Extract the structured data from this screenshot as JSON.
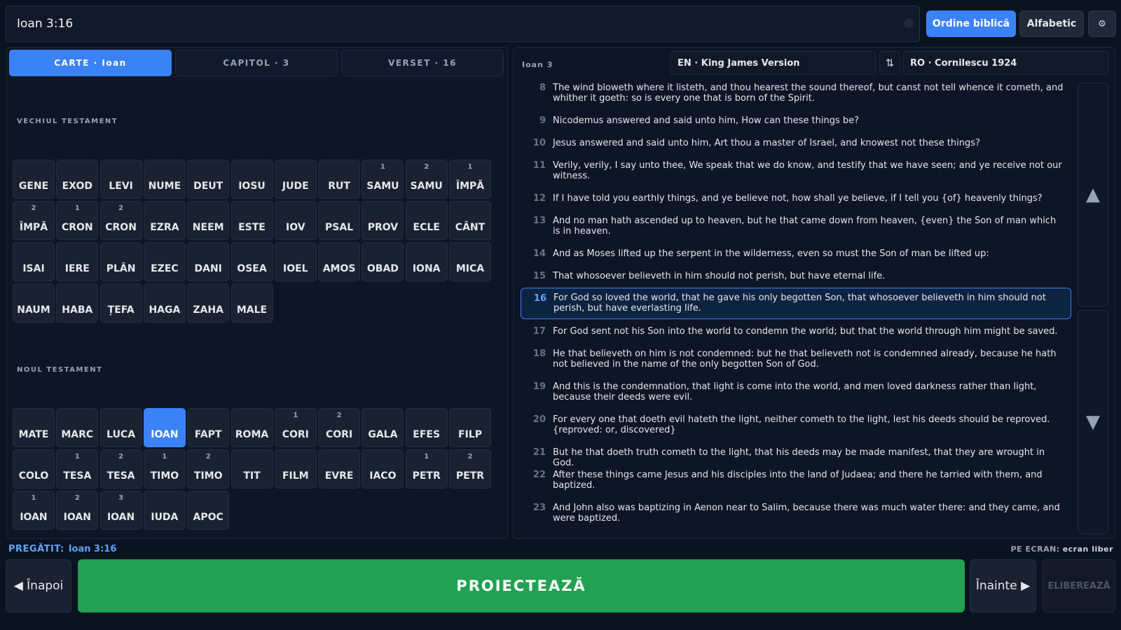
{
  "search": {
    "value": "Ioan 3:16"
  },
  "top_buttons": {
    "biblical_order": "Ordine biblică",
    "alphabetic": "Alfabetic",
    "settings_icon": "gear-icon",
    "settings_glyph": "⚙"
  },
  "tabs": [
    {
      "label": "CARTE  ·  Ioan"
    },
    {
      "label": "CAPITOL  ·  3"
    },
    {
      "label": "VERSET  ·  16"
    }
  ],
  "old_testament": {
    "title": "VECHIUL TESTAMENT",
    "books": [
      {
        "n": "GENE",
        "p": ""
      },
      {
        "n": "EXOD",
        "p": ""
      },
      {
        "n": "LEVI",
        "p": ""
      },
      {
        "n": "NUME",
        "p": ""
      },
      {
        "n": "DEUT",
        "p": ""
      },
      {
        "n": "IOSU",
        "p": ""
      },
      {
        "n": "JUDE",
        "p": ""
      },
      {
        "n": "RUT",
        "p": ""
      },
      {
        "n": "SAMU",
        "p": "1"
      },
      {
        "n": "SAMU",
        "p": "2"
      },
      {
        "n": "ÎMPĂ",
        "p": "1"
      },
      {
        "n": "ÎMPĂ",
        "p": "2"
      },
      {
        "n": "CRON",
        "p": "1"
      },
      {
        "n": "CRON",
        "p": "2"
      },
      {
        "n": "EZRA",
        "p": ""
      },
      {
        "n": "NEEM",
        "p": ""
      },
      {
        "n": "ESTE",
        "p": ""
      },
      {
        "n": "IOV",
        "p": ""
      },
      {
        "n": "PSAL",
        "p": ""
      },
      {
        "n": "PROV",
        "p": ""
      },
      {
        "n": "ECLE",
        "p": ""
      },
      {
        "n": "CÂNT",
        "p": ""
      },
      {
        "n": "ISAI",
        "p": ""
      },
      {
        "n": "IERE",
        "p": ""
      },
      {
        "n": "PLÂN",
        "p": ""
      },
      {
        "n": "EZEC",
        "p": ""
      },
      {
        "n": "DANI",
        "p": ""
      },
      {
        "n": "OSEA",
        "p": ""
      },
      {
        "n": "IOEL",
        "p": ""
      },
      {
        "n": "AMOS",
        "p": ""
      },
      {
        "n": "OBAD",
        "p": ""
      },
      {
        "n": "IONA",
        "p": ""
      },
      {
        "n": "MICA",
        "p": ""
      },
      {
        "n": "NAUM",
        "p": ""
      },
      {
        "n": "HABA",
        "p": ""
      },
      {
        "n": "ȚEFA",
        "p": ""
      },
      {
        "n": "HAGA",
        "p": ""
      },
      {
        "n": "ZAHA",
        "p": ""
      },
      {
        "n": "MALE",
        "p": ""
      }
    ]
  },
  "new_testament": {
    "title": "NOUL TESTAMENT",
    "books": [
      {
        "n": "MATE",
        "p": ""
      },
      {
        "n": "MARC",
        "p": ""
      },
      {
        "n": "LUCA",
        "p": ""
      },
      {
        "n": "IOAN",
        "p": "",
        "selected": true
      },
      {
        "n": "FAPT",
        "p": ""
      },
      {
        "n": "ROMA",
        "p": ""
      },
      {
        "n": "CORI",
        "p": "1"
      },
      {
        "n": "CORI",
        "p": "2"
      },
      {
        "n": "GALA",
        "p": ""
      },
      {
        "n": "EFES",
        "p": ""
      },
      {
        "n": "FILP",
        "p": ""
      },
      {
        "n": "COLO",
        "p": ""
      },
      {
        "n": "TESA",
        "p": "1"
      },
      {
        "n": "TESA",
        "p": "2"
      },
      {
        "n": "TIMO",
        "p": "1"
      },
      {
        "n": "TIMO",
        "p": "2"
      },
      {
        "n": "TIT",
        "p": ""
      },
      {
        "n": "FILM",
        "p": ""
      },
      {
        "n": "EVRE",
        "p": ""
      },
      {
        "n": "IACO",
        "p": ""
      },
      {
        "n": "PETR",
        "p": "1"
      },
      {
        "n": "PETR",
        "p": "2"
      },
      {
        "n": "IOAN",
        "p": "1"
      },
      {
        "n": "IOAN",
        "p": "2"
      },
      {
        "n": "IOAN",
        "p": "3"
      },
      {
        "n": "IUDA",
        "p": ""
      },
      {
        "n": "APOC",
        "p": ""
      }
    ]
  },
  "reader": {
    "chapter": "Ioan 3",
    "version_left": "EN  ·  King James Version",
    "version_right": "RO  ·  Cornilescu 1924",
    "swap_glyph": "⇅",
    "verses": [
      {
        "num": "8",
        "text": "The wind bloweth where it listeth, and thou hearest the sound thereof, but canst not tell whence it cometh, and whither it goeth: so is every one that is born of the Spirit."
      },
      {
        "num": "9",
        "text": "Nicodemus answered and said unto him, How can these things be?"
      },
      {
        "num": "10",
        "text": "Jesus answered and said unto him, Art thou a master of Israel, and knowest not these things?"
      },
      {
        "num": "11",
        "text": "Verily, verily, I say unto thee, We speak that we do know, and testify that we have seen; and ye receive not our witness."
      },
      {
        "num": "12",
        "text": "If I have told you earthly things, and ye believe not, how shall ye believe, if I tell you {of} heavenly things?"
      },
      {
        "num": "13",
        "text": "And no man hath ascended up to heaven, but he that came down from heaven, {even} the Son of man which is in heaven."
      },
      {
        "num": "14",
        "text": "And as Moses lifted up the serpent in the wilderness, even so must the Son of man be lifted up:"
      },
      {
        "num": "15",
        "text": "That whosoever believeth in him should not perish, but have eternal life."
      },
      {
        "num": "16",
        "text": "For God so loved the world, that he gave his only begotten Son, that whosoever believeth in him should not perish, but have everlasting life.",
        "selected": true
      },
      {
        "num": "17",
        "text": "For God sent not his Son into the world to condemn the world; but that the world through him might be saved."
      },
      {
        "num": "18",
        "text": "He that believeth on him is not condemned: but he that believeth not is condemned already, because he hath not believed in the name of the only begotten Son of God."
      },
      {
        "num": "19",
        "text": "And this is the condemnation, that light is come into the world, and men loved darkness rather than light, because their deeds were evil."
      },
      {
        "num": "20",
        "text": "For every one that doeth evil hateth the light, neither cometh to the light, lest his deeds should be reproved. {reproved: or, discovered}"
      },
      {
        "num": "21",
        "text": "But he that doeth truth cometh to the light, that his deeds may be made manifest, that they are wrought in God."
      },
      {
        "num": "22",
        "text": "After these things came Jesus and his disciples into the land of Judaea; and there he tarried with them, and baptized."
      },
      {
        "num": "23",
        "text": "And John also was baptizing in Aenon near to Salim, because there was much water there: and they came, and were baptized."
      }
    ],
    "scroll_up_glyph": "▲",
    "scroll_down_glyph": "▼"
  },
  "status": {
    "ready_label": "PREGĂTIT:",
    "ready_value": "Ioan 3:16",
    "onscreen_label": "PE ECRAN:",
    "onscreen_value": "ecran liber"
  },
  "bottom_buttons": {
    "back": "◀ Înapoi",
    "project": "PROIECTEAZĂ",
    "next": "Înainte ▶",
    "release": "ELIBEREAZĂ"
  },
  "colors": {
    "accent": "#3b82f6",
    "project_green": "#22a152",
    "background": "#0b1220"
  }
}
